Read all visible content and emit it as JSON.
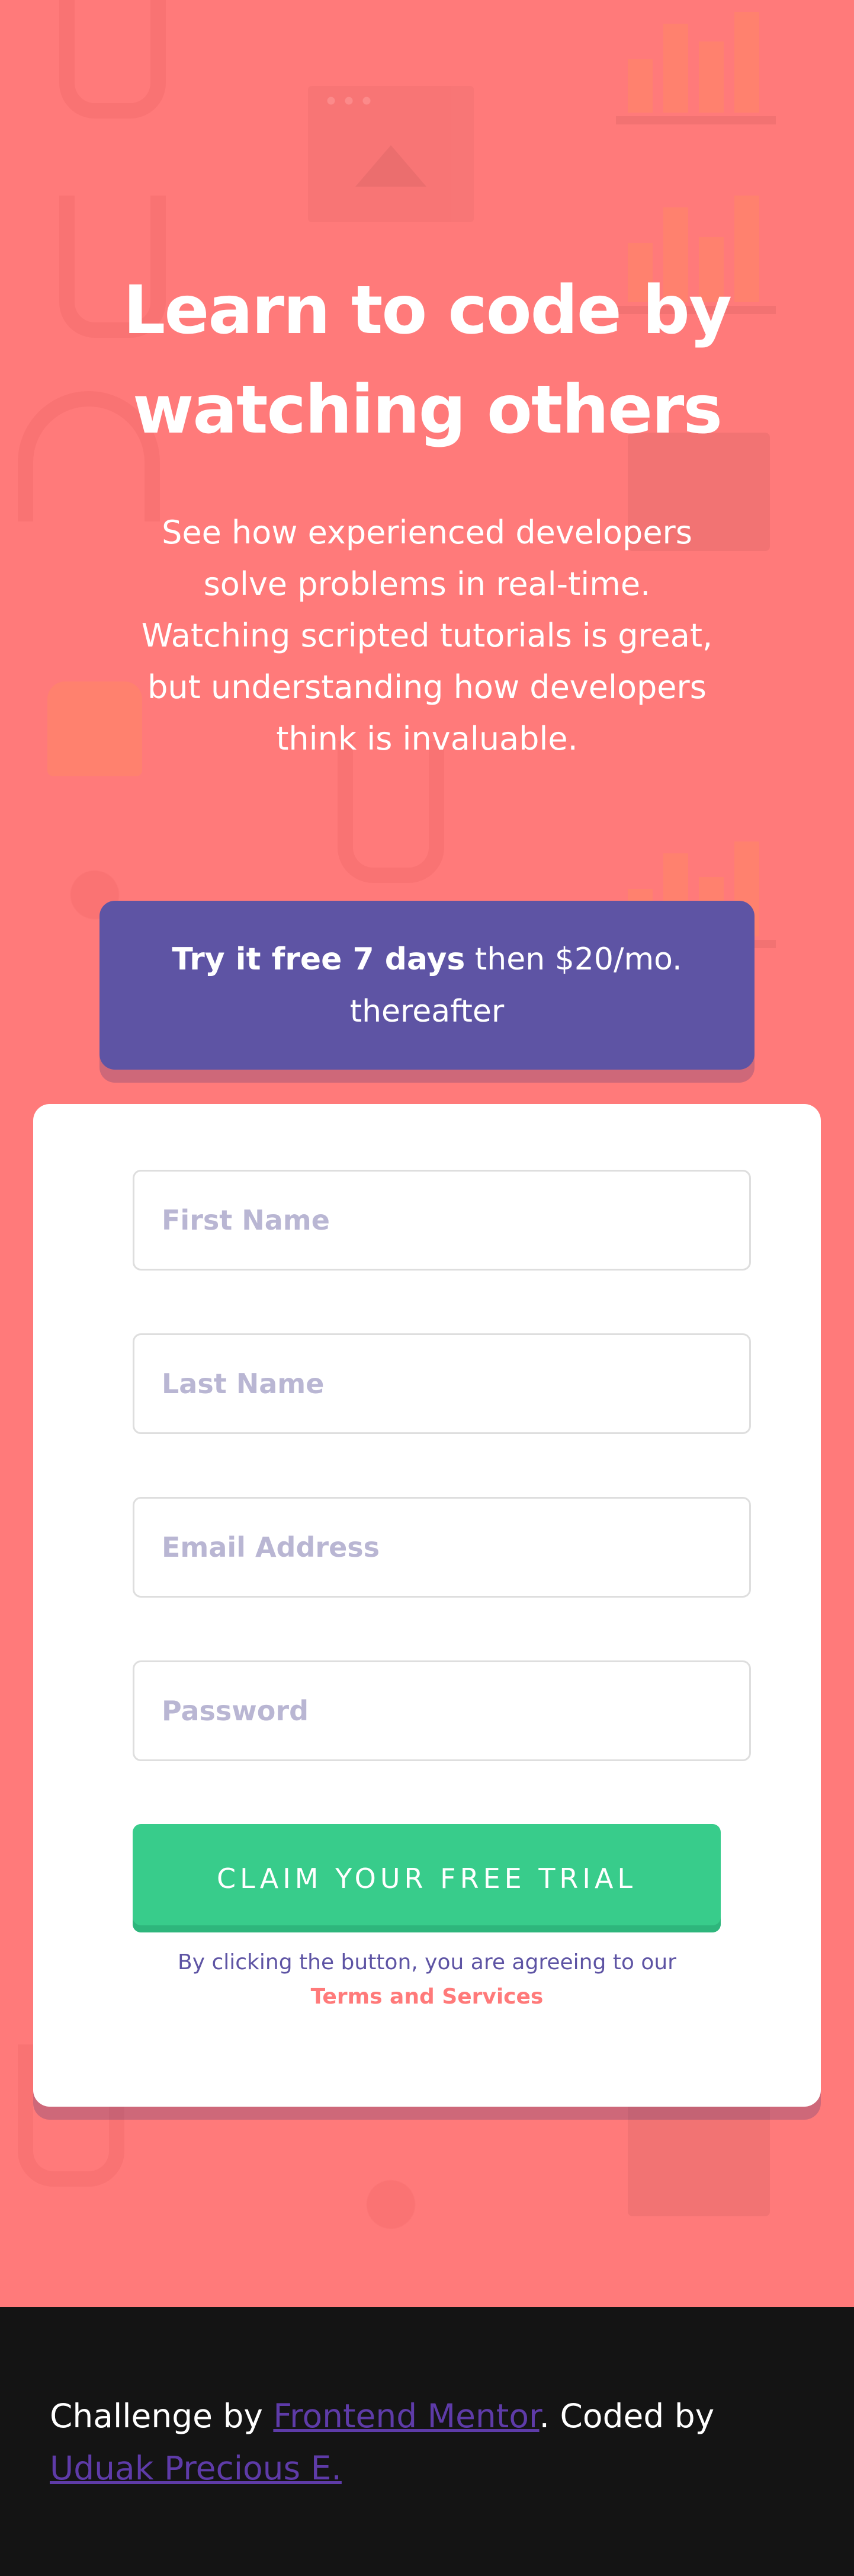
{
  "hero": {
    "title": "Learn to code by watching others",
    "text": "See how experienced developers solve problems in real-time. Watching scripted tutorials is great, but understanding how developers think is invaluable."
  },
  "promo": {
    "strong": "Try it free 7 days",
    "rest": " then $20/mo. thereafter"
  },
  "form": {
    "first_name_placeholder": "First Name",
    "last_name_placeholder": "Last Name",
    "email_placeholder": "Email Address",
    "password_placeholder": "Password",
    "submit_label": "CLAIM YOUR FREE TRIAL",
    "legal_text": "By clicking the button, you are agreeing to our",
    "legal_link": "Terms and Services"
  },
  "footer": {
    "prefix": "Challenge by ",
    "mentor_link": "Frontend Mentor",
    "middle": ". Coded by ",
    "author_link": "Uduak Precious E."
  },
  "colors": {
    "background": "#ff7a7a",
    "promo": "#5e54a4",
    "cta": "#38cc8b",
    "footer": "#141414",
    "placeholder": "#b9b6d3"
  }
}
